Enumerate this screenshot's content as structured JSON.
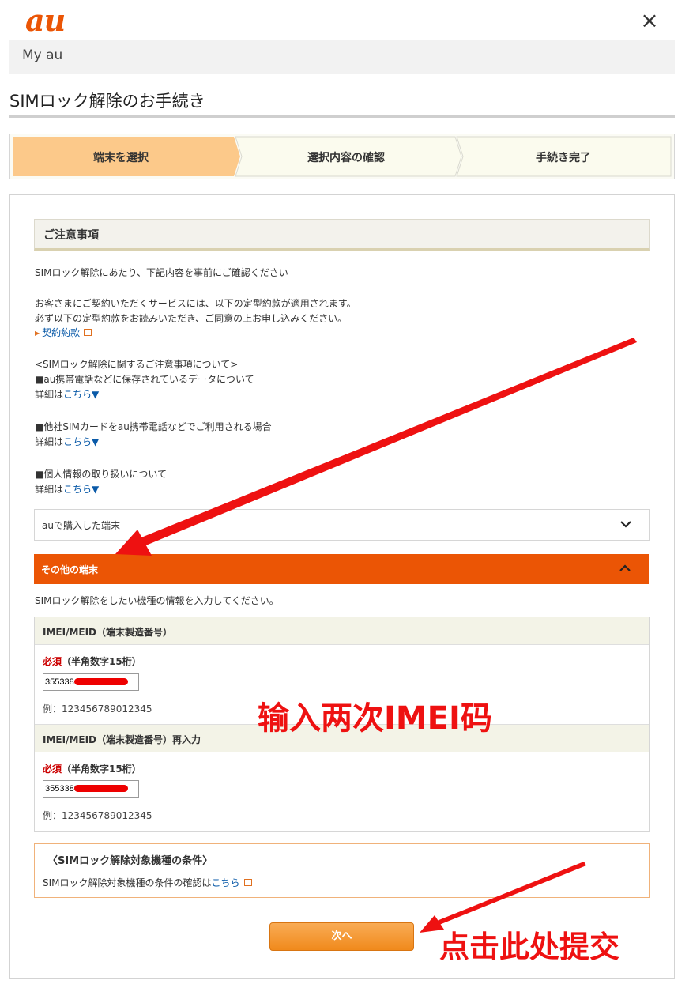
{
  "header": {
    "logo_text": "au",
    "close_symbol": "×",
    "myau_label": "My au",
    "page_title": "SIMロック解除のお手続き"
  },
  "steps": [
    {
      "label": "端末を選択",
      "active": true
    },
    {
      "label": "選択内容の確認",
      "active": false
    },
    {
      "label": "手続き完了",
      "active": false
    }
  ],
  "notice": {
    "heading": "ご注意事項",
    "intro": "SIMロック解除にあたり、下記内容を事前にご確認ください",
    "terms_line1": "お客さまにご契約いただくサービスには、以下の定型約款が適用されます。",
    "terms_line2": "必ず以下の定型約款をお読みいただき、ご同意の上お申し込みください。",
    "terms_link": "契約約款",
    "section_title": "<SIMロック解除に関するご注意事項について>",
    "items": [
      {
        "title": "■au携帯電話などに保存されているデータについて",
        "detail_prefix": "詳細は",
        "detail_link": "こちら▼"
      },
      {
        "title": "■他社SIMカードをau携帯電話などでご利用される場合",
        "detail_prefix": "詳細は",
        "detail_link": "こちら▼"
      },
      {
        "title": "■個人情報の取り扱いについて",
        "detail_prefix": "詳細は",
        "detail_link": "こちら▼"
      }
    ]
  },
  "accordion": {
    "au_device_label": "auで購入した端末",
    "other_device_label": "その他の端末",
    "instruction": "SIMロック解除をしたい機種の情報を入力してください。"
  },
  "form": {
    "imei_label": "IMEI/MEID（端末製造番号）",
    "imei_reenter_label": "IMEI/MEID（端末製造番号）再入力",
    "required_tag": "必須",
    "required_hint": "（半角数字15桁）",
    "imei_value": "355338",
    "imei_confirm_value": "3553380",
    "example": "例：123456789012345"
  },
  "conditions": {
    "title": "〈SIMロック解除対象機種の条件〉",
    "text_prefix": "SIMロック解除対象機種の条件の確認は",
    "link": "こちら"
  },
  "next_button_label": "次へ",
  "annotations": {
    "imei_note": "输入两次IMEI码",
    "submit_note": "点击此处提交"
  },
  "colors": {
    "brand_orange": "#eb5505",
    "active_step": "#fcc98a",
    "link_blue": "#0a5aa8",
    "annotation_red": "#ee1111"
  }
}
